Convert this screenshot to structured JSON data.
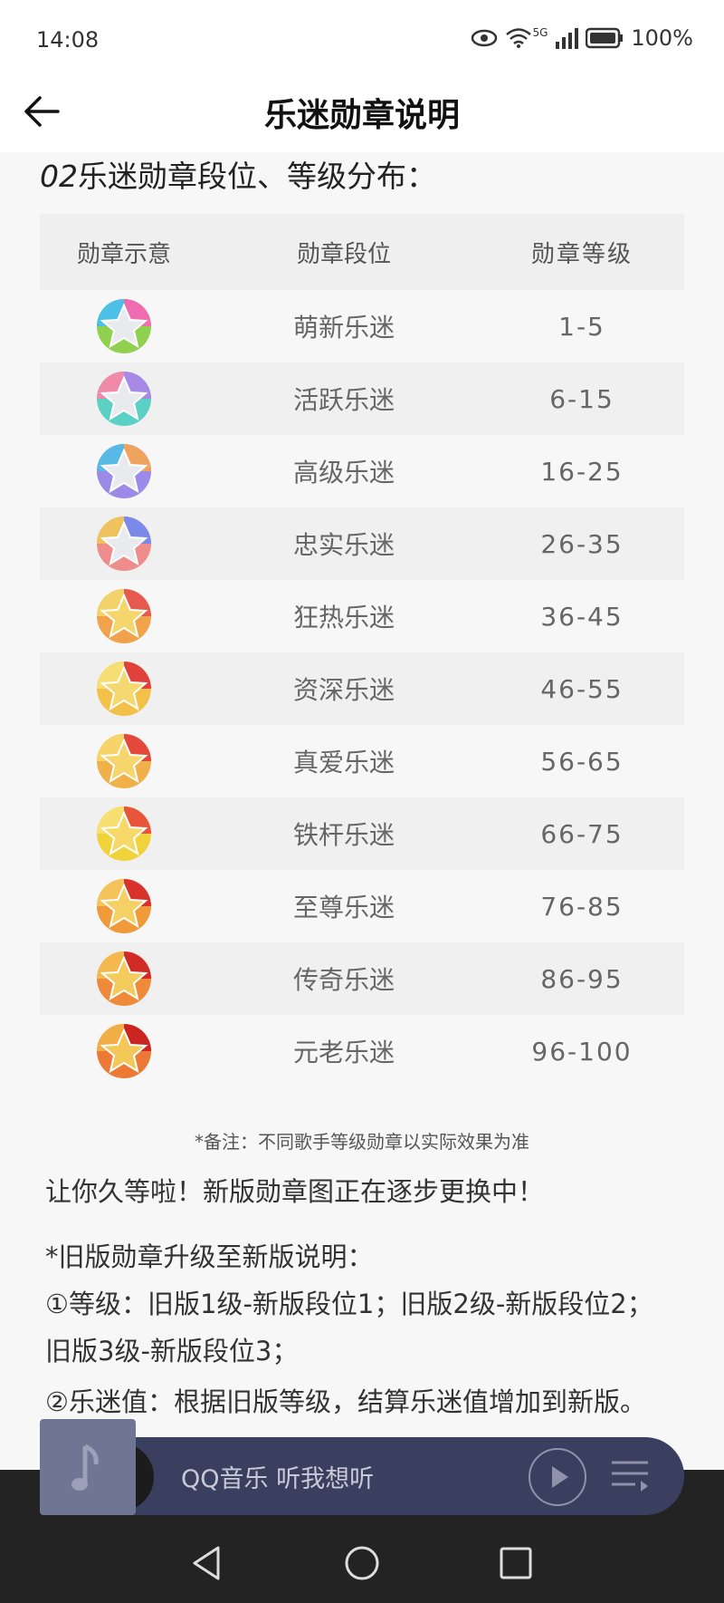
{
  "status": {
    "time": "14:08",
    "network": "5G",
    "battery": "100%"
  },
  "header": {
    "title": "乐迷勋章说明"
  },
  "section": {
    "number": "02",
    "title": "乐迷勋章段位、等级分布："
  },
  "table": {
    "headers": [
      "勋章示意",
      "勋章段位",
      "勋章等级"
    ],
    "rows": [
      {
        "tier": "萌新乐迷",
        "levels": "1-5"
      },
      {
        "tier": "活跃乐迷",
        "levels": "6-15"
      },
      {
        "tier": "高级乐迷",
        "levels": "16-25"
      },
      {
        "tier": "忠实乐迷",
        "levels": "26-35"
      },
      {
        "tier": "狂热乐迷",
        "levels": "36-45"
      },
      {
        "tier": "资深乐迷",
        "levels": "46-55"
      },
      {
        "tier": "真爱乐迷",
        "levels": "56-65"
      },
      {
        "tier": "铁杆乐迷",
        "levels": "66-75"
      },
      {
        "tier": "至尊乐迷",
        "levels": "76-85"
      },
      {
        "tier": "传奇乐迷",
        "levels": "86-95"
      },
      {
        "tier": "元老乐迷",
        "levels": "96-100"
      }
    ]
  },
  "note": "*备注：不同歌手等级勋章以实际效果为准",
  "body": {
    "p1": "让你久等啦！新版勋章图正在逐步更换中！",
    "p2": "*旧版勋章升级至新版说明：",
    "p3": "①等级：旧版1级-新版段位1；旧版2级-新版段位2；",
    "p4": "旧版3级-新版段位3；",
    "p5": "②乐迷值：根据旧版等级，结算乐迷值增加到新版。"
  },
  "player": {
    "track": "QQ音乐 听我想听"
  },
  "icons": [
    "eye-icon",
    "wifi-icon",
    "signal-icon",
    "battery-icon",
    "back-arrow-icon",
    "medal-icon",
    "music-note-icon",
    "play-icon",
    "playlist-icon",
    "nav-back-icon",
    "nav-home-icon",
    "nav-recents-icon"
  ]
}
